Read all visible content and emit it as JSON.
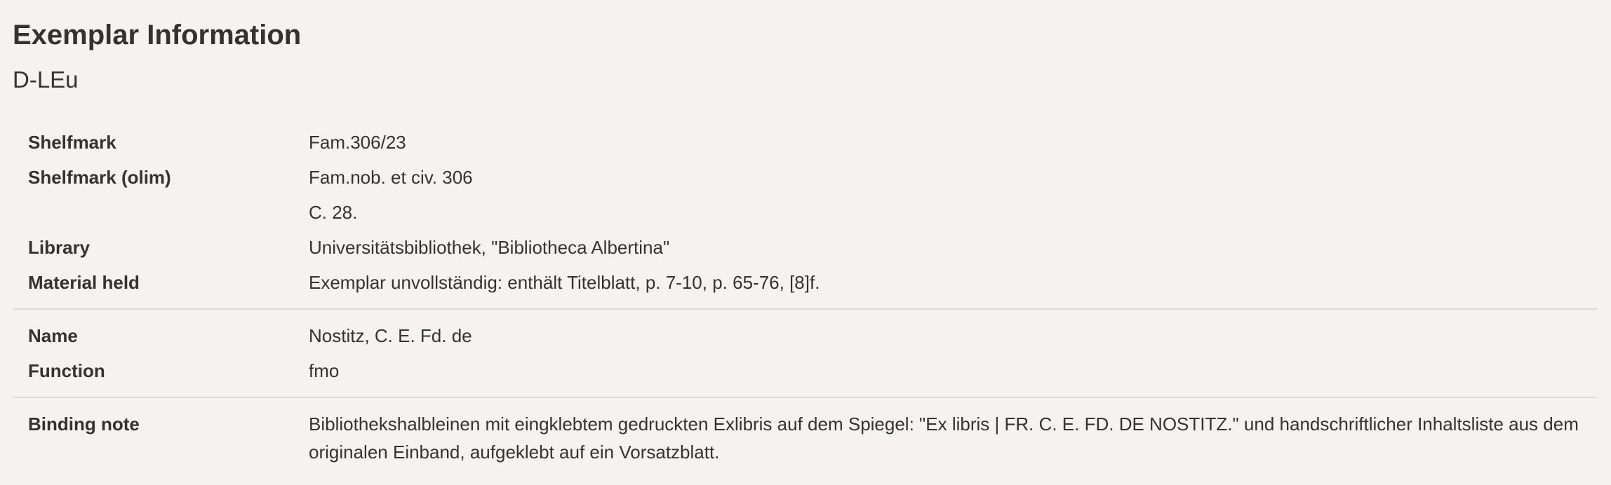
{
  "header": {
    "title": "Exemplar Information",
    "siglum": "D-LEu"
  },
  "groups": [
    {
      "rows": [
        {
          "label": "Shelfmark",
          "value": "Fam.306/23"
        },
        {
          "label": "Shelfmark (olim)",
          "value": "Fam.nob. et civ. 306"
        },
        {
          "label": "",
          "value": "C. 28."
        },
        {
          "label": "Library",
          "value": "Universitätsbibliothek, \"Bibliotheca Albertina\""
        },
        {
          "label": "Material held",
          "value": "Exemplar unvollständig: enthält Titelblatt, p. 7-10, p. 65-76, [8]f."
        }
      ]
    },
    {
      "rows": [
        {
          "label": "Name",
          "value": "Nostitz, C. E. Fd. de"
        },
        {
          "label": "Function",
          "value": "fmo"
        }
      ]
    },
    {
      "rows": [
        {
          "label": "Binding note",
          "value": "Bibliothekshalbleinen mit eingklebtem gedruckten Exlibris auf dem Spiegel: \"Ex libris | FR. C. E. FD. DE NOSTITZ.\" und handschriftlicher Inhaltsliste aus dem originalen Einband, aufgeklebt auf ein Vorsatzblatt."
        }
      ]
    }
  ]
}
